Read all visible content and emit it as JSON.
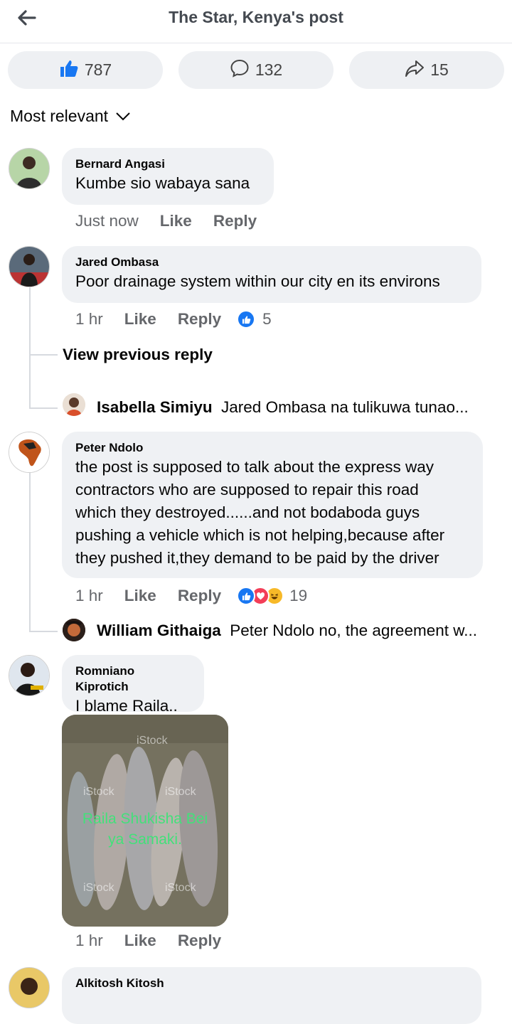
{
  "header": {
    "title": "The Star, Kenya's post"
  },
  "stats": {
    "likes": "787",
    "comments": "132",
    "shares": "15"
  },
  "sort": {
    "label": "Most relevant"
  },
  "comments": [
    {
      "name": "Bernard Angasi",
      "text": "Kumbe sio wabaya sana",
      "time": "Just now",
      "like": "Like",
      "reply": "Reply"
    },
    {
      "name": "Jared Ombasa",
      "text": "Poor drainage system within our city en its environs",
      "time": "1 hr",
      "like": "Like",
      "reply": "Reply",
      "reactions": "5",
      "view_previous": "View previous reply",
      "reply_preview": {
        "name": "Isabella Simiyu",
        "text": "Jared Ombasa na tulikuwa tunao..."
      }
    },
    {
      "name": "Peter Ndolo",
      "text_lines": [
        "the post is supposed to talk about the express way",
        "contractors who are supposed to repair this road",
        "which they destroyed......and not bodaboda guys",
        "pushing a vehicle which is not helping,because after",
        "they pushed it,they demand to be paid by the driver"
      ],
      "time": "1 hr",
      "like": "Like",
      "reply": "Reply",
      "reactions": "19",
      "reply_preview": {
        "name": "William Githaiga",
        "text": "Peter Ndolo no, the agreement w..."
      }
    },
    {
      "name": "Romniano Kiprotich",
      "text": "I blame Raila..",
      "time": "1 hr",
      "like": "Like",
      "reply": "Reply",
      "image": {
        "watermark": "iStock",
        "caption_line1": "Raila Shukisha Bei",
        "caption_line2": "ya Samaki."
      }
    },
    {
      "name": "Alkitosh Kitosh"
    }
  ],
  "colors": {
    "like_blue": "#1877f2",
    "love_red": "#f33e58",
    "haha_yellow": "#f7b928",
    "bubble_bg": "#eff1f4",
    "meta_gray": "#65676b"
  }
}
